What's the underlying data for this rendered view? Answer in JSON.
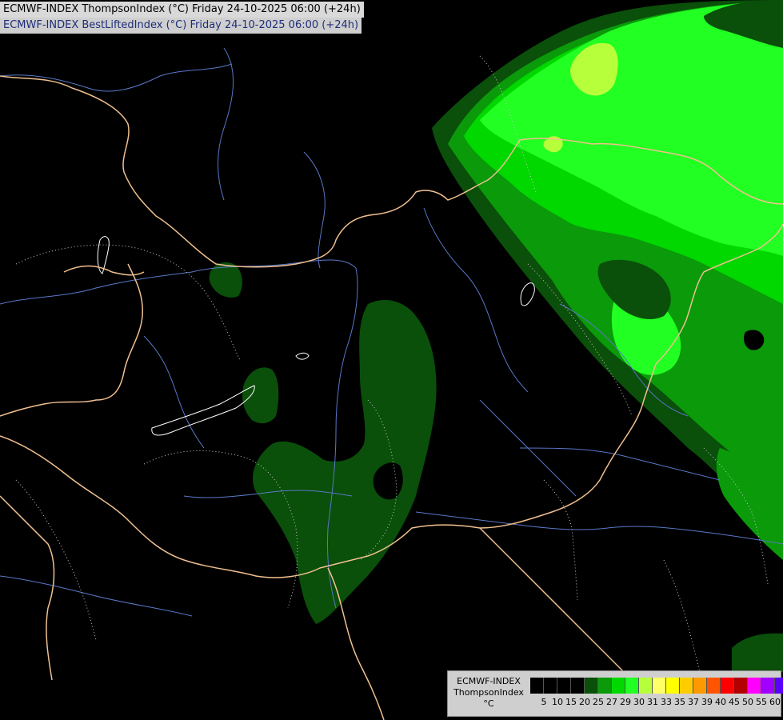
{
  "titles": {
    "line1": "ECMWF-INDEX ThompsonIndex (°C) Friday 24-10-2025 06:00 (+24h)",
    "line2": "ECMWF-INDEX BestLiftedIndex (°C) Friday 24-10-2025 06:00 (+24h)"
  },
  "legend": {
    "model": "ECMWF-INDEX",
    "parameter": "ThompsonIndex",
    "unit": "°C",
    "ticks": [
      "5",
      "10",
      "15",
      "20",
      "25",
      "27",
      "29",
      "30",
      "31",
      "33",
      "35",
      "37",
      "39",
      "40",
      "45",
      "50",
      "55",
      "60"
    ],
    "colors": [
      "#000000",
      "#000000",
      "#000000",
      "#000000",
      "#0a4f0a",
      "#0a9a0a",
      "#00d800",
      "#22ff22",
      "#b6ff3a",
      "#ffff66",
      "#ffff00",
      "#ffcc00",
      "#ff9900",
      "#ff5500",
      "#ff0000",
      "#b30000",
      "#ff00ff",
      "#a000ff",
      "#5a00ff",
      "#0000ff"
    ]
  },
  "palette": {
    "background": "#000000",
    "borders": "#f0c090",
    "rivers": "#5a78c8",
    "lakes": "#ffffff",
    "isolines": "#c8c8c8",
    "green_dark": "#0a4f0a",
    "green_mid": "#0a9a0a",
    "green_bright": "#00d800",
    "green_light": "#22ff22",
    "yellow_green": "#b6ff3a"
  }
}
